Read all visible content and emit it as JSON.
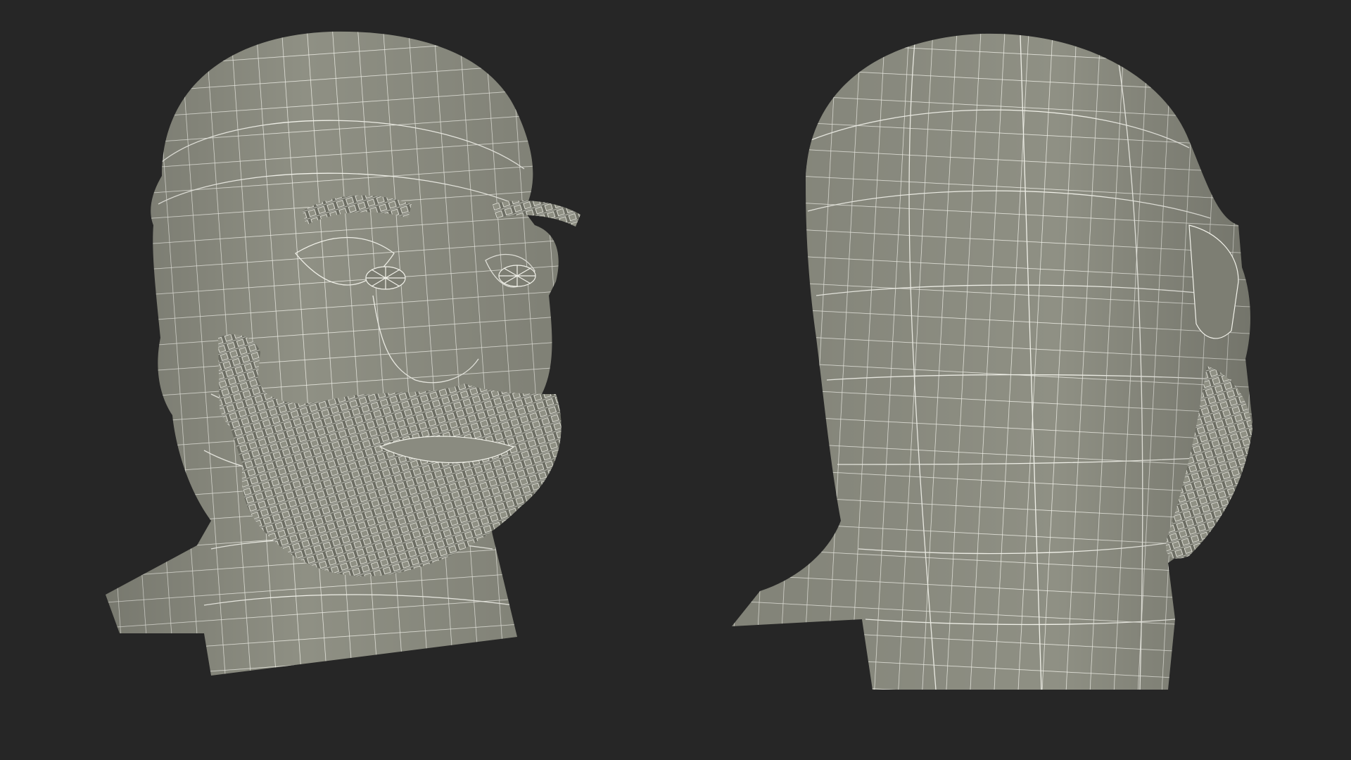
{
  "scene": {
    "background_color": "#262626",
    "mesh_fill_color": "#8f9084",
    "mesh_shadow_color": "#6c6d63",
    "wire_color": "#f2f2ea",
    "views": [
      {
        "name": "front-three-quarter",
        "has_beard": true,
        "has_eyes": true,
        "has_eyebrows": true
      },
      {
        "name": "back-three-quarter",
        "has_beard": true,
        "has_eyes": false,
        "has_eyebrows": false
      }
    ]
  }
}
